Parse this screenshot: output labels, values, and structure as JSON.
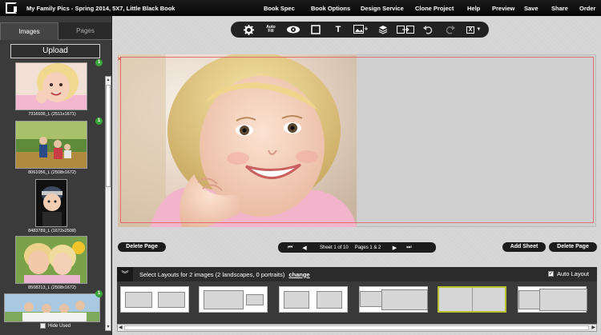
{
  "app": {
    "title": "My Family Pics - Spring 2014, 5X7, Little Black Book",
    "menu": [
      "Book Spec",
      "Book Options",
      "Design Service",
      "Clone Project",
      "Help",
      "Preview",
      "Save",
      "Share",
      "Order"
    ]
  },
  "left": {
    "tabs": [
      "Images",
      "Pages"
    ],
    "upload_label": "Upload",
    "thumbnails": [
      {
        "caption": "7316936_L (2511x1671)",
        "badge": "1"
      },
      {
        "caption": "8061056_L (2508x1672)",
        "badge": "1"
      },
      {
        "caption": "8483789_L (1672x2508)",
        "badge": ""
      },
      {
        "caption": "8508213_L (2508x1672)",
        "badge": ""
      },
      {
        "caption": "",
        "badge": "1"
      }
    ],
    "hide_used_label": "Hide Used"
  },
  "toolbar": {
    "autofill_label_1": "Auto",
    "autofill_label_2": "Fill",
    "text_tool": "T",
    "x_label": "X"
  },
  "canvas": {
    "delete_left": "Delete Page",
    "delete_right": "Delete Page",
    "add_sheet": "Add Sheet",
    "sheet_info": "Sheet 1 of 10",
    "pages_info": "Pages 1 & 2"
  },
  "layouts": {
    "header_text": "Select Layouts for 2 images (2 landscapes, 0 portraits)",
    "change_label": "change",
    "auto_layout_label": "Auto Layout",
    "auto_layout_checked": true
  },
  "colors": {
    "accent_selected": "#b9c32f",
    "badge": "#3aa53a",
    "bleed_line": "#e07070"
  }
}
